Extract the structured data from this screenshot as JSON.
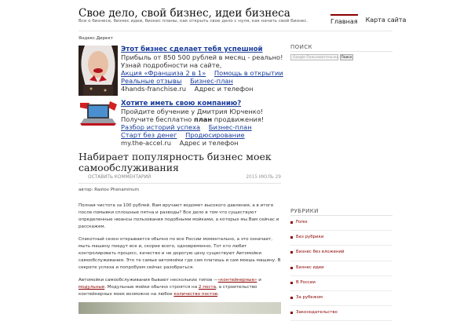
{
  "header": {
    "title": "Свое дело, свой бизнес, идеи бизнеса",
    "description": "Все о бизнесе, бизнес идеи, бизнес планы, как открыть свое дело с нуля, как начать свой бизнес.",
    "nav": [
      {
        "label": "Главная",
        "active": true
      },
      {
        "label": "Карта сайта",
        "active": false
      }
    ]
  },
  "ads": {
    "label": "Яндекс.Директ",
    "items": [
      {
        "title": "Этот бизнес сделает тебя успешной",
        "body": "Прибыль от 850 500 рублей в месяц - реально! Узнай подробности на сайте,",
        "links_row1": [
          "Акция «Франшиза 2 в 1»",
          "Помощь в открытии"
        ],
        "links_row2": [
          "Реальные отзывы",
          "Бизнес-план"
        ],
        "domain": "4hands-franchise.ru",
        "address": "Адрес и телефон"
      },
      {
        "title": "Хотите иметь свою компанию?",
        "body_before": "Пройдите обучение у Дмитрия Юрченко! Получите бесплатно ",
        "body_bold": "план",
        "body_after": " продвижения!",
        "links_row1": [
          "Разбор историй успеха",
          "Бизнес-план"
        ],
        "links_row2": [
          "Старт без денег",
          "Продюсирование"
        ],
        "domain": "my.the-accel.ru",
        "address": "Адрес и телефон"
      }
    ]
  },
  "post": {
    "title": "Набирает популярность бизнес моек самообслуживания",
    "comment_link": "ОСТАВИТЬ КОММЕНТАРИЙ",
    "date_year": "2015",
    "date_day": "ИЮЛЬ 29",
    "author": "автор: Rastov Phenaminum",
    "p1": "Полная чистота за 100 рублей. Вам вручают водомет высокого давления, а в итоге после помывки сплошные пятна и разводы? Все дело в том что существуют определенные нюансы пользования подобными мойками, а которых мы Вам сейчас и расскажем.",
    "p2": "Спекотный сезон открывается обычно по все России моментально, а это означает, мыть машину поедут все и, скорее всего, одновременно. Тот кто любит контролировать процесс, качество и не дорогую цену существуют Автомойки самообслуживания. Это те самые автомойки где сам платишь и сам моешь машину. В секрете успеха и попробуем сейчас разобраться.",
    "p3_a": "Автомойки самообслуживания бывают нескольких типов —",
    "p3_link1": "«контейнерные»",
    "p3_b": " и ",
    "p3_link2": "модульные",
    "p3_c": ". Модульные мойки обычно строятся на ",
    "p3_link3": "2 поста",
    "p3_d": ", а строительство контейнерных моек возможно на любое ",
    "p3_link4": "количество постов",
    "p3_e": "."
  },
  "sidebar": {
    "search_heading": "ПОИСК",
    "search_placeholder": "Google Пользовательский поиск",
    "search_button": "Поиск",
    "rubrics_heading": "РУБРИКИ",
    "categories": [
      "Forex",
      "Без рубрики",
      "Бизнес без вложений",
      "Бизнес идеи",
      "В России",
      "За рубежом",
      "Законодательство"
    ]
  },
  "colors": {
    "accent": "#8b0000",
    "ad_link": "#1a3d9a"
  }
}
